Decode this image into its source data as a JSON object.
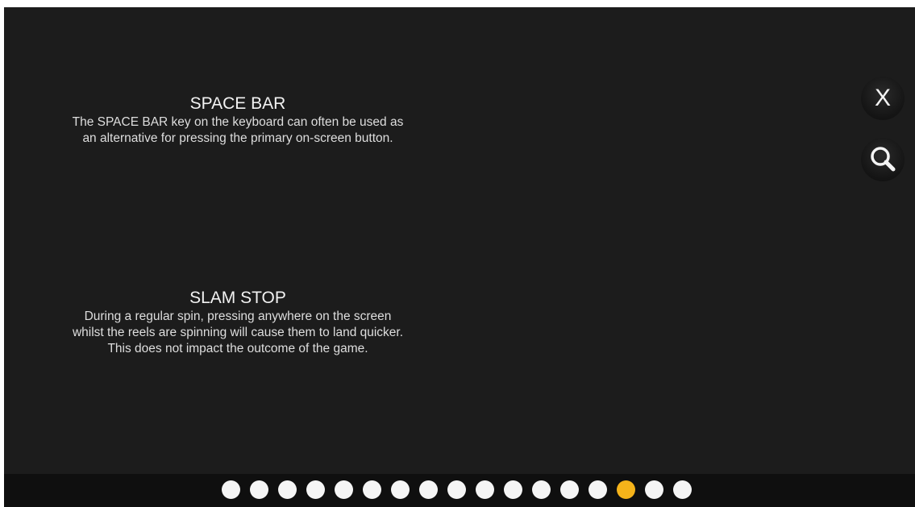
{
  "sections": [
    {
      "title": "SPACE BAR",
      "body": "The SPACE BAR key on the keyboard can often be used as an alternative for pressing the primary on-screen button."
    },
    {
      "title": "SLAM STOP",
      "body": "During a regular spin, pressing anywhere on the screen whilst the reels are spinning will cause them to land quicker. This does not impact the outcome of the game."
    }
  ],
  "close_button": {
    "label": "X",
    "icon": "close-icon"
  },
  "zoom_button": {
    "icon": "magnifier-icon"
  },
  "pagination": {
    "total_pages": 17,
    "active_page": 15,
    "active_color": "#f5b31a",
    "inactive_color": "#f5f5f5"
  }
}
